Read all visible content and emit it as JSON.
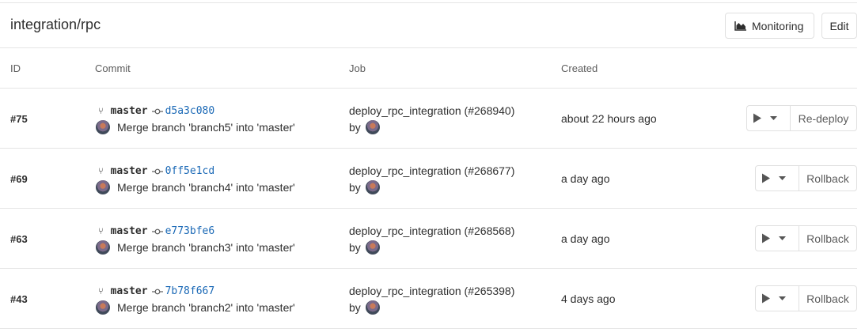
{
  "header": {
    "title": "integration/rpc",
    "monitoring_label": "Monitoring",
    "edit_label": "Edit"
  },
  "columns": {
    "id": "ID",
    "commit": "Commit",
    "job": "Job",
    "created": "Created"
  },
  "deployments": [
    {
      "id": "#75",
      "branch": "master",
      "sha": "d5a3c080",
      "message": "Merge branch 'branch5' into 'master'",
      "job": "deploy_rpc_integration (#268940)",
      "by": "by",
      "created": "about 22 hours ago",
      "action": "Re-deploy"
    },
    {
      "id": "#69",
      "branch": "master",
      "sha": "0ff5e1cd",
      "message": "Merge branch 'branch4' into 'master'",
      "job": "deploy_rpc_integration (#268677)",
      "by": "by",
      "created": "a day ago",
      "action": "Rollback"
    },
    {
      "id": "#63",
      "branch": "master",
      "sha": "e773bfe6",
      "message": "Merge branch 'branch3' into 'master'",
      "job": "deploy_rpc_integration (#268568)",
      "by": "by",
      "created": "a day ago",
      "action": "Rollback"
    },
    {
      "id": "#43",
      "branch": "master",
      "sha": "7b78f667",
      "message": "Merge branch 'branch2' into 'master'",
      "job": "deploy_rpc_integration (#265398)",
      "by": "by",
      "created": "4 days ago",
      "action": "Rollback"
    }
  ],
  "icons": {
    "branch": "branch-icon",
    "commit": "commit-icon",
    "monitoring": "area-chart-icon",
    "play": "play-icon",
    "caret": "caret-down-icon"
  },
  "colors": {
    "sha_link": "#1b69b6",
    "border": "#e0e0e0",
    "text": "#2e2e2e"
  }
}
